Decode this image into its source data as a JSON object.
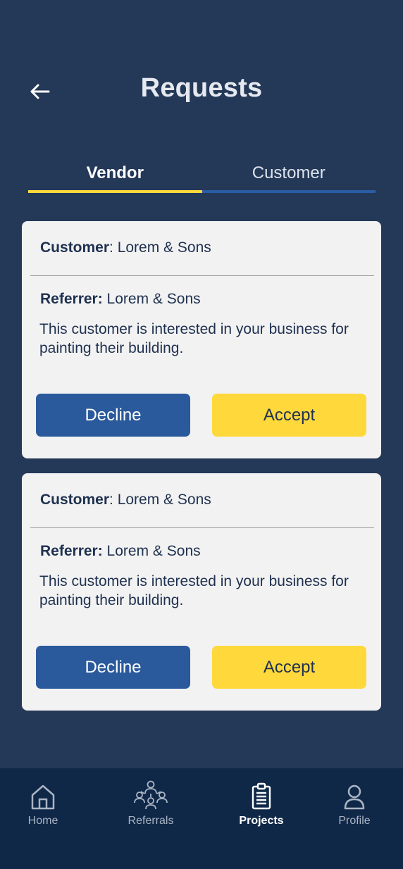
{
  "header": {
    "title": "Requests",
    "back_icon": "arrow-left-icon"
  },
  "tabs": [
    {
      "label": "Vendor",
      "active": true
    },
    {
      "label": "Customer",
      "active": false
    }
  ],
  "requests": [
    {
      "customer_label": "Customer",
      "customer_value": ": Lorem & Sons",
      "referrer_label": "Referrer:",
      "referrer_value": " Lorem & Sons",
      "description": "This customer is interested in your business for painting their building.",
      "decline_label": "Decline",
      "accept_label": "Accept"
    },
    {
      "customer_label": "Customer",
      "customer_value": ": Lorem & Sons",
      "referrer_label": "Referrer:",
      "referrer_value": " Lorem & Sons",
      "description": "This customer is interested in your business for painting their building.",
      "decline_label": "Decline",
      "accept_label": "Accept"
    }
  ],
  "nav": [
    {
      "label": "Home",
      "icon": "home-icon",
      "active": false
    },
    {
      "label": "Referrals",
      "icon": "network-icon",
      "active": false
    },
    {
      "label": "Projects",
      "icon": "clipboard-icon",
      "active": true
    },
    {
      "label": "Profile",
      "icon": "user-icon",
      "active": false
    }
  ],
  "colors": {
    "background": "#243858",
    "nav_background": "#102848",
    "card": "#f2f2f2",
    "accent_yellow": "#ffd83b",
    "accent_blue": "#2a5a9c",
    "text_dark": "#1f3150"
  }
}
